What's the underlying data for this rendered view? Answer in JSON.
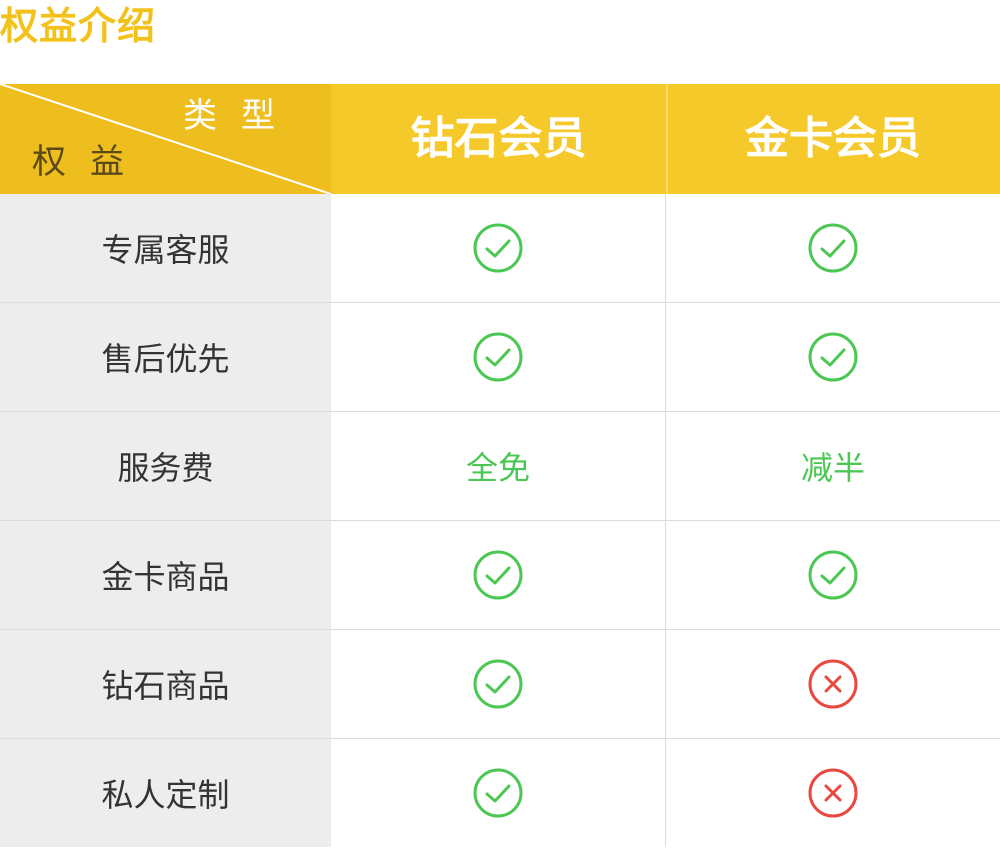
{
  "title": "权益介绍",
  "header": {
    "corner_type": "类型",
    "corner_rights": "权益",
    "columns": [
      "钻石会员",
      "金卡会员"
    ]
  },
  "colors": {
    "title": "#f2c21b",
    "header_bg": "#f6c92a",
    "check": "#4cc753",
    "cross": "#e8483f",
    "label_bg": "#ededed"
  },
  "rows": [
    {
      "label": "专属客服",
      "diamond": {
        "type": "check"
      },
      "gold": {
        "type": "check"
      }
    },
    {
      "label": "售后优先",
      "diamond": {
        "type": "check"
      },
      "gold": {
        "type": "check"
      }
    },
    {
      "label": "服务费",
      "diamond": {
        "type": "text",
        "text": "全免"
      },
      "gold": {
        "type": "text",
        "text": "减半"
      }
    },
    {
      "label": "金卡商品",
      "diamond": {
        "type": "check"
      },
      "gold": {
        "type": "check"
      }
    },
    {
      "label": "钻石商品",
      "diamond": {
        "type": "check"
      },
      "gold": {
        "type": "cross"
      }
    },
    {
      "label": "私人定制",
      "diamond": {
        "type": "check"
      },
      "gold": {
        "type": "cross"
      }
    }
  ]
}
